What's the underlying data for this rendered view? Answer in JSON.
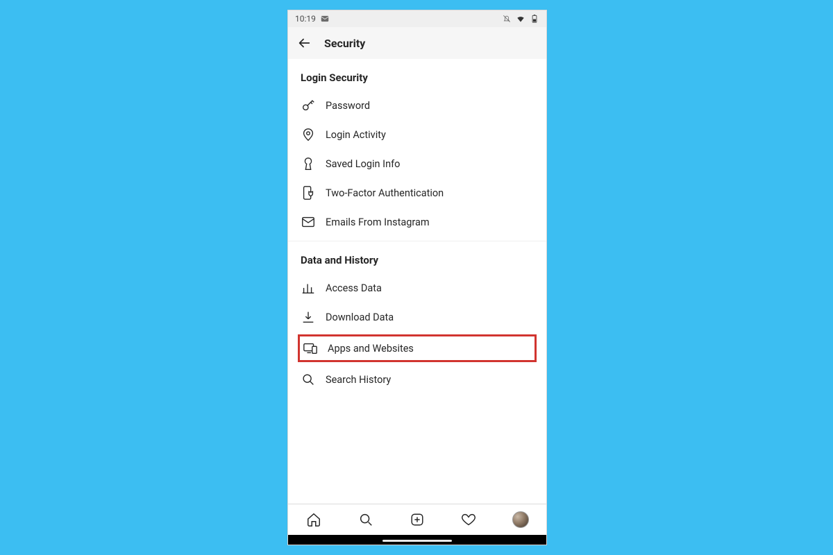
{
  "status": {
    "time": "10:19",
    "icons": {
      "mail": "mail-icon",
      "dnd": "bell-off-icon",
      "wifi": "wifi-icon",
      "battery": "battery-icon"
    }
  },
  "header": {
    "title": "Security"
  },
  "sections": [
    {
      "title": "Login Security",
      "items": [
        {
          "icon": "key-icon",
          "label": "Password",
          "highlight": false
        },
        {
          "icon": "location-pin-icon",
          "label": "Login Activity",
          "highlight": false
        },
        {
          "icon": "keyhole-icon",
          "label": "Saved Login Info",
          "highlight": false
        },
        {
          "icon": "phone-shield-icon",
          "label": "Two-Factor Authentication",
          "highlight": false
        },
        {
          "icon": "envelope-icon",
          "label": "Emails From Instagram",
          "highlight": false
        }
      ]
    },
    {
      "title": "Data and History",
      "items": [
        {
          "icon": "bar-chart-icon",
          "label": "Access Data",
          "highlight": false
        },
        {
          "icon": "download-icon",
          "label": "Download Data",
          "highlight": false
        },
        {
          "icon": "devices-icon",
          "label": "Apps and Websites",
          "highlight": true
        },
        {
          "icon": "search-icon",
          "label": "Search History",
          "highlight": false
        }
      ]
    }
  ],
  "highlight_color": "#d1342f",
  "bottom_nav": {
    "items": [
      "home",
      "search",
      "create",
      "activity",
      "profile"
    ]
  }
}
